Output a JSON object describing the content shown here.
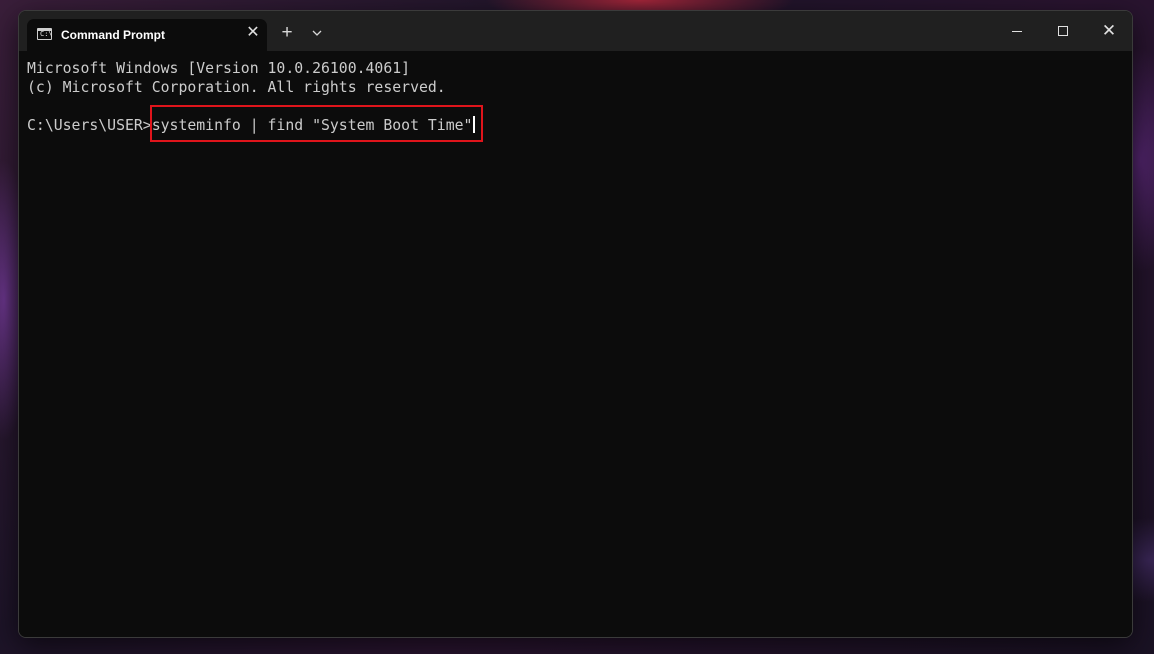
{
  "window": {
    "tab_title": "Command Prompt",
    "tab_icon": "cmd-icon",
    "tab_icon_glyph": "C:\\",
    "close_tab_glyph": "✕",
    "new_tab_glyph": "+",
    "dropdown_icon": "chevron-down-icon",
    "controls": {
      "minimize_icon": "minimize-icon",
      "maximize_icon": "maximize-icon",
      "close_icon": "close-icon",
      "close_glyph": "✕"
    }
  },
  "terminal": {
    "header_line_1": "Microsoft Windows [Version 10.0.26100.4061]",
    "header_line_2": "(c) Microsoft Corporation. All rights reserved.",
    "prompt": "C:\\Users\\USER>",
    "command": "systeminfo | find \"System Boot Time\"",
    "highlight_color": "#e0141b",
    "background_color": "#0c0c0c",
    "text_color": "#cccccc"
  }
}
